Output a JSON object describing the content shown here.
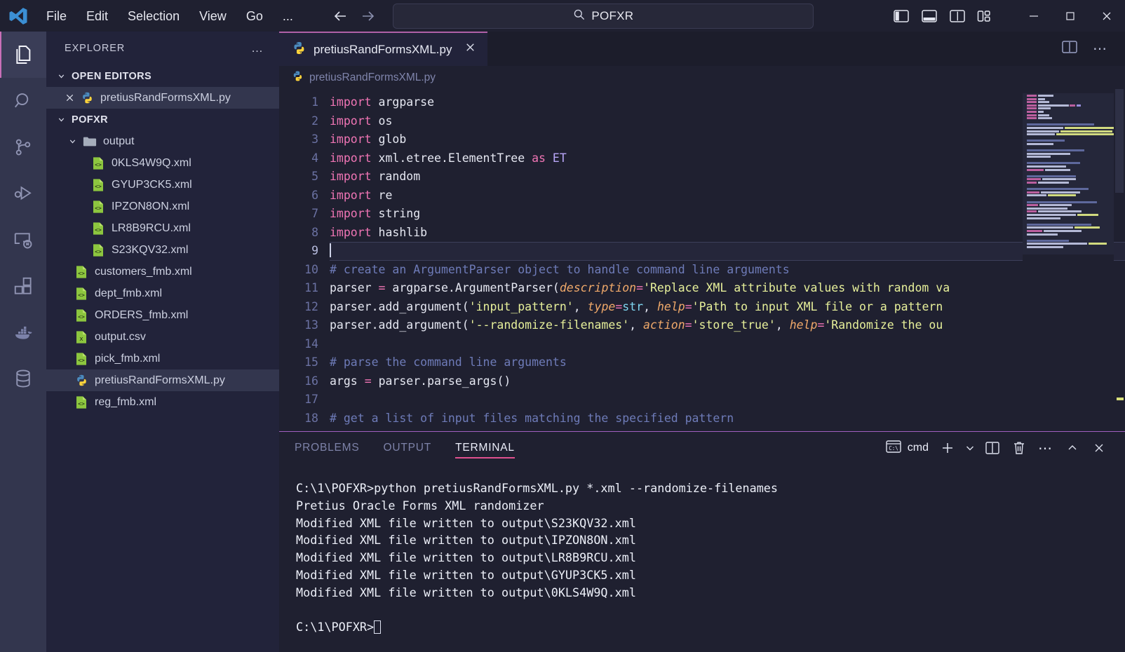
{
  "titlebar": {
    "logo_icon": "vscode-logo-icon",
    "menu": [
      {
        "label": "File"
      },
      {
        "label": "Edit"
      },
      {
        "label": "Selection"
      },
      {
        "label": "View"
      },
      {
        "label": "Go"
      },
      {
        "label": "..."
      }
    ],
    "nav": {
      "back_icon": "arrow-left-icon",
      "forward_icon": "arrow-right-icon"
    },
    "search": {
      "icon": "search-icon",
      "value": "POFXR",
      "placeholder": "Search"
    },
    "layout_icons": [
      {
        "name": "toggle-primary-sidebar-icon"
      },
      {
        "name": "toggle-panel-icon"
      },
      {
        "name": "toggle-secondary-sidebar-icon"
      },
      {
        "name": "customize-layout-icon"
      }
    ],
    "window_controls": [
      {
        "name": "minimize-button",
        "glyph": "—"
      },
      {
        "name": "maximize-button",
        "glyph": "□"
      },
      {
        "name": "close-button",
        "glyph": "✕"
      }
    ]
  },
  "activitybar": {
    "items": [
      {
        "name": "explorer",
        "icon": "files-icon",
        "active": true
      },
      {
        "name": "search",
        "icon": "search-icon",
        "active": false
      },
      {
        "name": "source-control",
        "icon": "source-control-icon",
        "active": false
      },
      {
        "name": "run-and-debug",
        "icon": "run-debug-icon",
        "active": false
      },
      {
        "name": "remote-explorer",
        "icon": "remote-explorer-icon",
        "active": false
      },
      {
        "name": "extensions",
        "icon": "extensions-icon",
        "active": false
      },
      {
        "name": "docker",
        "icon": "docker-icon",
        "active": false
      },
      {
        "name": "database",
        "icon": "database-icon",
        "active": false
      }
    ]
  },
  "sidebar": {
    "title": "EXPLORER",
    "more_actions_label": "…",
    "open_editors": {
      "label": "OPEN EDITORS",
      "expanded": true,
      "items": [
        {
          "label": "pretiusRandFormsXML.py",
          "icon": "python-file-icon",
          "close_icon": "close-icon",
          "selected": true
        }
      ]
    },
    "workspace": {
      "label": "POFXR",
      "expanded": true,
      "items": [
        {
          "label": "output",
          "icon": "folder-icon",
          "kind": "folder",
          "depth": 1,
          "expanded": true
        },
        {
          "label": "0KLS4W9Q.xml",
          "icon": "xml-file-icon",
          "kind": "file",
          "depth": 2
        },
        {
          "label": "GYUP3CK5.xml",
          "icon": "xml-file-icon",
          "kind": "file",
          "depth": 2
        },
        {
          "label": "IPZON8ON.xml",
          "icon": "xml-file-icon",
          "kind": "file",
          "depth": 2
        },
        {
          "label": "LR8B9RCU.xml",
          "icon": "xml-file-icon",
          "kind": "file",
          "depth": 2
        },
        {
          "label": "S23KQV32.xml",
          "icon": "xml-file-icon",
          "kind": "file",
          "depth": 2
        },
        {
          "label": "customers_fmb.xml",
          "icon": "xml-file-icon",
          "kind": "file",
          "depth": 1
        },
        {
          "label": "dept_fmb.xml",
          "icon": "xml-file-icon",
          "kind": "file",
          "depth": 1
        },
        {
          "label": "ORDERS_fmb.xml",
          "icon": "xml-file-icon",
          "kind": "file",
          "depth": 1
        },
        {
          "label": "output.csv",
          "icon": "csv-file-icon",
          "kind": "file",
          "depth": 1
        },
        {
          "label": "pick_fmb.xml",
          "icon": "xml-file-icon",
          "kind": "file",
          "depth": 1
        },
        {
          "label": "pretiusRandFormsXML.py",
          "icon": "python-file-icon",
          "kind": "file",
          "depth": 1,
          "selected": true
        },
        {
          "label": "reg_fmb.xml",
          "icon": "xml-file-icon",
          "kind": "file",
          "depth": 1
        }
      ]
    }
  },
  "editor": {
    "tabs": [
      {
        "label": "pretiusRandFormsXML.py",
        "icon": "python-file-icon",
        "close_icon": "close-icon",
        "active": true
      }
    ],
    "tab_actions": [
      {
        "name": "split-editor-right-icon"
      },
      {
        "name": "more-actions-icon",
        "glyph": "…"
      }
    ],
    "breadcrumb": {
      "icon": "python-file-icon",
      "label": "pretiusRandFormsXML.py"
    },
    "cursor_line": 9,
    "lines": [
      {
        "n": 1,
        "text": "import argparse"
      },
      {
        "n": 2,
        "text": "import os"
      },
      {
        "n": 3,
        "text": "import glob"
      },
      {
        "n": 4,
        "text": "import xml.etree.ElementTree as ET"
      },
      {
        "n": 5,
        "text": "import random"
      },
      {
        "n": 6,
        "text": "import re"
      },
      {
        "n": 7,
        "text": "import string"
      },
      {
        "n": 8,
        "text": "import hashlib"
      },
      {
        "n": 9,
        "text": ""
      },
      {
        "n": 10,
        "text": "# create an ArgumentParser object to handle command line arguments"
      },
      {
        "n": 11,
        "text": "parser = argparse.ArgumentParser(description='Replace XML attribute values with random va"
      },
      {
        "n": 12,
        "text": "parser.add_argument('input_pattern', type=str, help='Path to input XML file or a pattern"
      },
      {
        "n": 13,
        "text": "parser.add_argument('--randomize-filenames', action='store_true', help='Randomize the out"
      },
      {
        "n": 14,
        "text": ""
      },
      {
        "n": 15,
        "text": "# parse the command line arguments"
      },
      {
        "n": 16,
        "text": "args = parser.parse_args()"
      },
      {
        "n": 17,
        "text": ""
      },
      {
        "n": 18,
        "text": "# get a list of input files matching the specified pattern"
      }
    ]
  },
  "panel": {
    "tabs": [
      {
        "label": "PROBLEMS",
        "active": false
      },
      {
        "label": "OUTPUT",
        "active": false
      },
      {
        "label": "TERMINAL",
        "active": true
      }
    ],
    "shell": {
      "icon": "terminal-cmd-icon",
      "label": "cmd"
    },
    "actions": [
      {
        "name": "new-terminal-icon",
        "glyph": "+"
      },
      {
        "name": "chevron-down-icon",
        "glyph": "⌄"
      },
      {
        "name": "split-terminal-icon"
      },
      {
        "name": "kill-terminal-icon"
      },
      {
        "name": "terminal-more-actions-icon",
        "glyph": "…"
      },
      {
        "name": "maximize-panel-icon",
        "glyph": "⌃"
      },
      {
        "name": "close-panel-icon",
        "glyph": "✕"
      }
    ],
    "terminal_lines": [
      "C:\\1\\POFXR>python pretiusRandFormsXML.py *.xml --randomize-filenames",
      "Pretius Oracle Forms XML randomizer",
      "Modified XML file written to output\\S23KQV32.xml",
      "Modified XML file written to output\\IPZON8ON.xml",
      "Modified XML file written to output\\LR8B9RCU.xml",
      "Modified XML file written to output\\GYUP3CK5.xml",
      "Modified XML file written to output\\0KLS4W9Q.xml",
      "",
      ""
    ],
    "prompt": "C:\\1\\POFXR>"
  },
  "colors": {
    "titlebar_bg": "#1f2030",
    "activitybar_bg": "#33364e",
    "sidebar_bg": "#22233a",
    "editor_bg": "#1f2030",
    "accent_pink": "#e0508f",
    "tab_border": "#b060a8",
    "panel_border": "#a05fc0",
    "keyword": "#f075b5",
    "string": "#e7f09a",
    "comment": "#6e7bb8",
    "param": "#f0a96a",
    "module": "#b8a6f8"
  }
}
